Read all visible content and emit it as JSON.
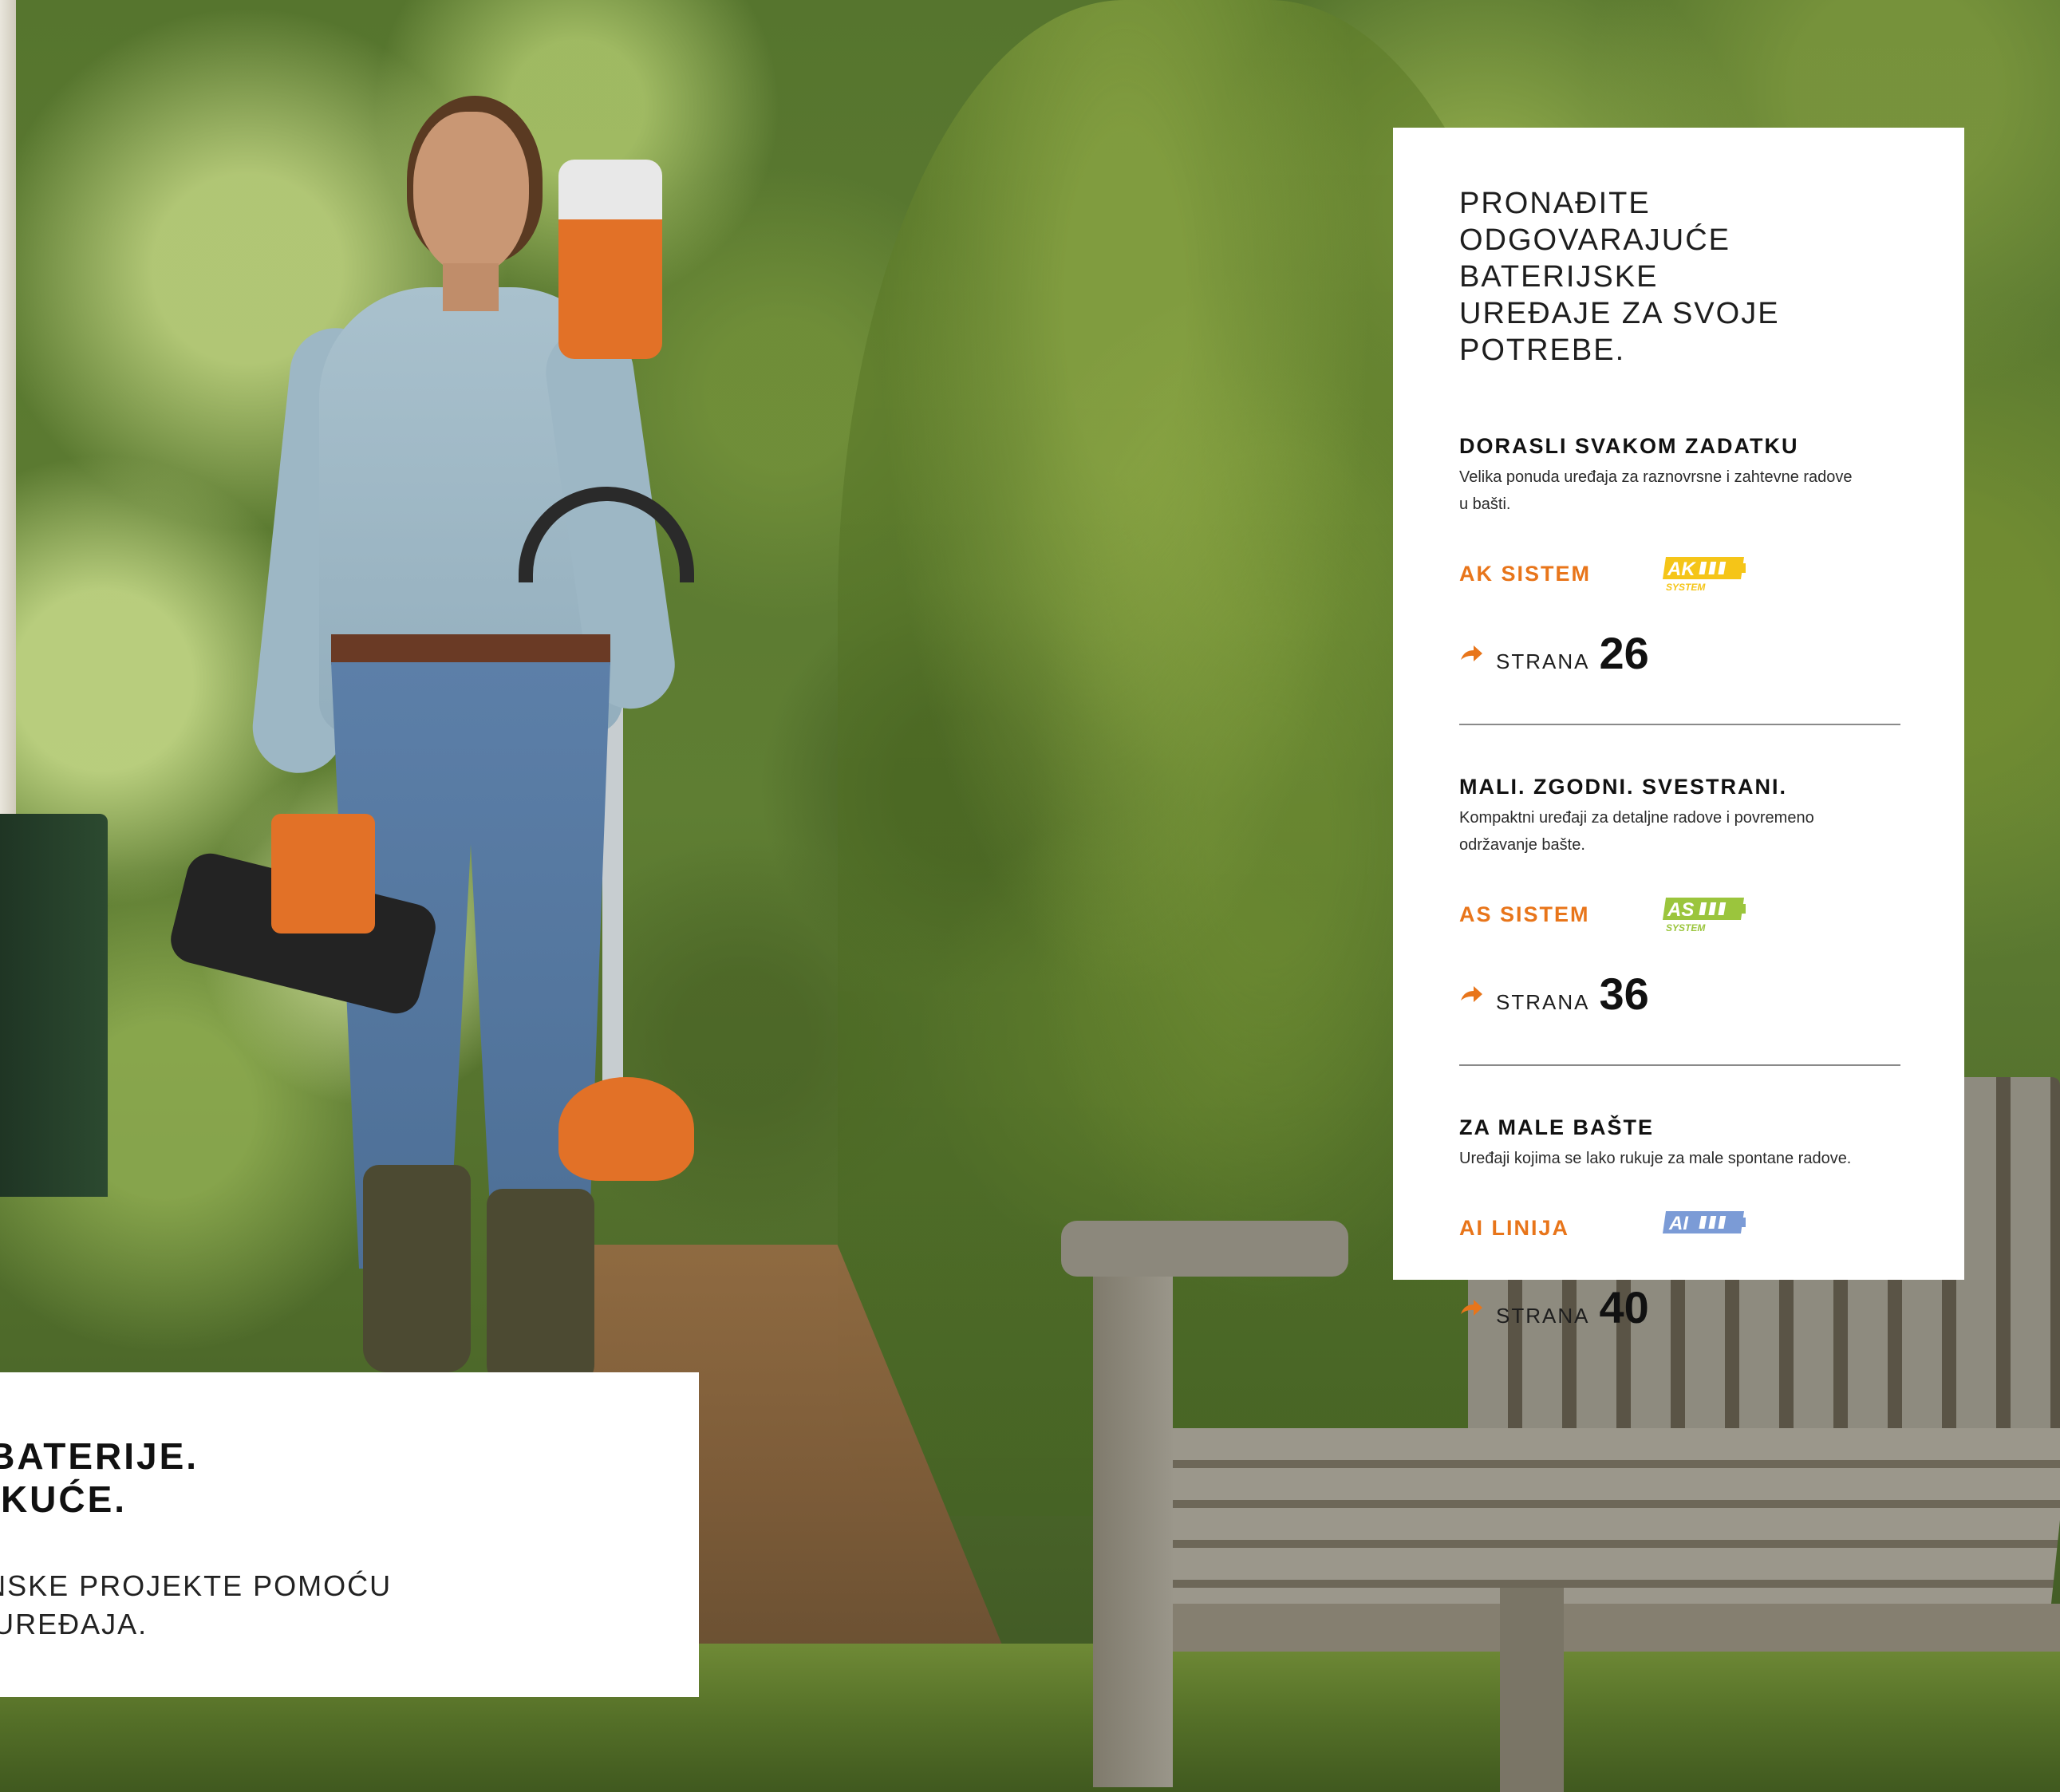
{
  "panel": {
    "headline": [
      "PRONAĐITE",
      "ODGOVARAJUĆE BATERIJSKE",
      "UREĐAJE ZA SVOJE POTREBE."
    ],
    "sections": [
      {
        "title": "DORASLI SVAKOM ZADATKU",
        "description": [
          "Velika ponuda uređaja za raznovrsne i zahtevne radove",
          "u bašti."
        ],
        "system_name": "AK SISTEM",
        "badge": {
          "text": "AK",
          "subtext": "SYSTEM",
          "color": "#f5c518"
        },
        "page_label": "STRANA",
        "page_number": "26"
      },
      {
        "title": "MALI. ZGODNI. SVESTRANI.",
        "description": [
          "Kompaktni uređaji za detaljne radove i povremeno",
          "održavanje bašte."
        ],
        "system_name": "AS SISTEM",
        "badge": {
          "text": "AS",
          "subtext": "SYSTEM",
          "color": "#9bc53d"
        },
        "page_label": "STRANA",
        "page_number": "36"
      },
      {
        "title": "ZA MALE BAŠTE",
        "description": [
          "Uređaji kojima se lako rukuje za male spontane radove."
        ],
        "system_name": "AI LINIJA",
        "badge": {
          "text": "AI",
          "subtext": "",
          "color": "#7b9bd6"
        },
        "page_label": "STRANA",
        "page_number": "40"
      }
    ]
  },
  "box2": {
    "title": [
      "SNAGA BATERIJE.",
      "ZA OKO KUĆE."
    ],
    "subtitle": [
      "REALIZUJTE BAŠTENSKE PROJEKTE POMOĆU",
      "STIHL BATERIJSKIH UREĐAJA."
    ]
  },
  "colors": {
    "accent": "#e8751a",
    "divider": "#8a8a8a"
  }
}
